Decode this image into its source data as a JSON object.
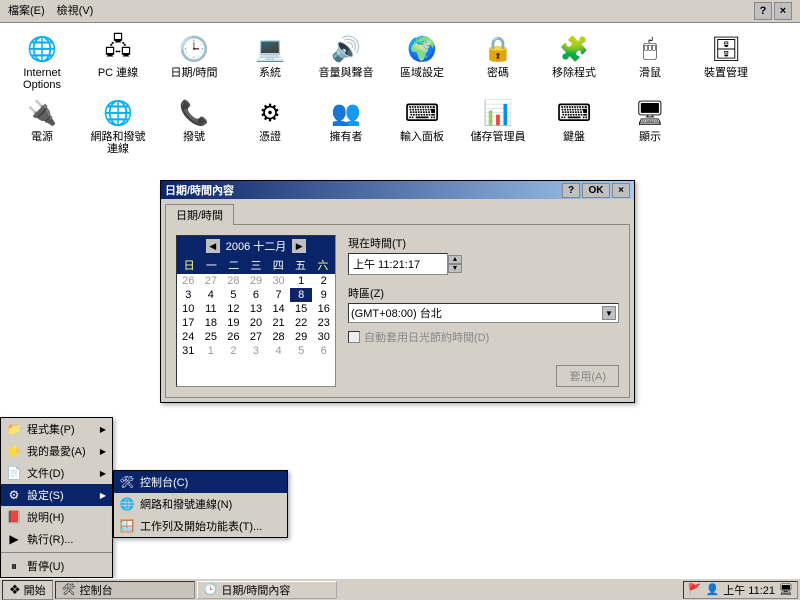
{
  "menubar": {
    "file": "檔案(E)",
    "view": "檢視(V)"
  },
  "icons_row1": [
    {
      "name": "internet-options",
      "label": "Internet Options",
      "glyph": "🌐"
    },
    {
      "name": "pc-connection",
      "label": "PC 連線",
      "glyph": "🖧"
    },
    {
      "name": "date-time",
      "label": "日期/時間",
      "glyph": "🕒"
    },
    {
      "name": "system",
      "label": "系統",
      "glyph": "💻"
    },
    {
      "name": "sound",
      "label": "音量與聲音",
      "glyph": "🔊"
    },
    {
      "name": "regional",
      "label": "區域設定",
      "glyph": "🌍"
    },
    {
      "name": "password",
      "label": "密碼",
      "glyph": "🔒"
    },
    {
      "name": "remove-programs",
      "label": "移除程式",
      "glyph": "🧩"
    },
    {
      "name": "mouse",
      "label": "滑鼠",
      "glyph": "🖱"
    },
    {
      "name": "device-mgmt",
      "label": "裝置管理",
      "glyph": "🗄"
    }
  ],
  "icons_row2": [
    {
      "name": "power",
      "label": "電源",
      "glyph": "🔌"
    },
    {
      "name": "network-dialup",
      "label": "網路和撥號連線",
      "glyph": "🌐"
    },
    {
      "name": "dialing",
      "label": "撥號",
      "glyph": "📞"
    },
    {
      "name": "certificates",
      "label": "憑證",
      "glyph": "⚙"
    },
    {
      "name": "owner",
      "label": "擁有者",
      "glyph": "👥"
    },
    {
      "name": "input-panel",
      "label": "輸入面板",
      "glyph": "⌨"
    },
    {
      "name": "storage-mgr",
      "label": "儲存管理員",
      "glyph": "📊"
    },
    {
      "name": "keyboard",
      "label": "鍵盤",
      "glyph": "⌨"
    },
    {
      "name": "display",
      "label": "顯示",
      "glyph": "🖥"
    }
  ],
  "dialog": {
    "title": "日期/時間內容",
    "ok": "OK",
    "tab": "日期/時間",
    "cal_title": "2006 十二月",
    "dow": [
      "日",
      "一",
      "二",
      "三",
      "四",
      "五",
      "六"
    ],
    "prev_gray": [
      26,
      27,
      28,
      29,
      30
    ],
    "days": [
      1,
      2,
      3,
      4,
      5,
      6,
      7,
      8,
      9,
      10,
      11,
      12,
      13,
      14,
      15,
      16,
      17,
      18,
      19,
      20,
      21,
      22,
      23,
      24,
      25,
      26,
      27,
      28,
      29,
      30,
      31
    ],
    "next_gray": [
      1,
      2,
      3,
      4,
      5,
      6
    ],
    "selected": 8,
    "time_label": "現在時間(T)",
    "time_value": "上午 11:21:17",
    "tz_label": "時區(Z)",
    "tz_value": "(GMT+08:00) 台北",
    "dst_label": "自動套用日光節約時間(D)",
    "apply": "套用(A)"
  },
  "startmenu": {
    "programs": "程式集(P)",
    "favorites": "我的最愛(A)",
    "documents": "文件(D)",
    "settings": "設定(S)",
    "help": "說明(H)",
    "run": "執行(R)...",
    "suspend": "暫停(U)"
  },
  "submenu": {
    "control_panel": "控制台(C)",
    "network": "網路和撥號連線(N)",
    "taskbar": "工作列及開始功能表(T)..."
  },
  "taskbar": {
    "start": "開始",
    "task1": "控制台",
    "task2": "日期/時間內容",
    "clock": "上午 11:21"
  }
}
